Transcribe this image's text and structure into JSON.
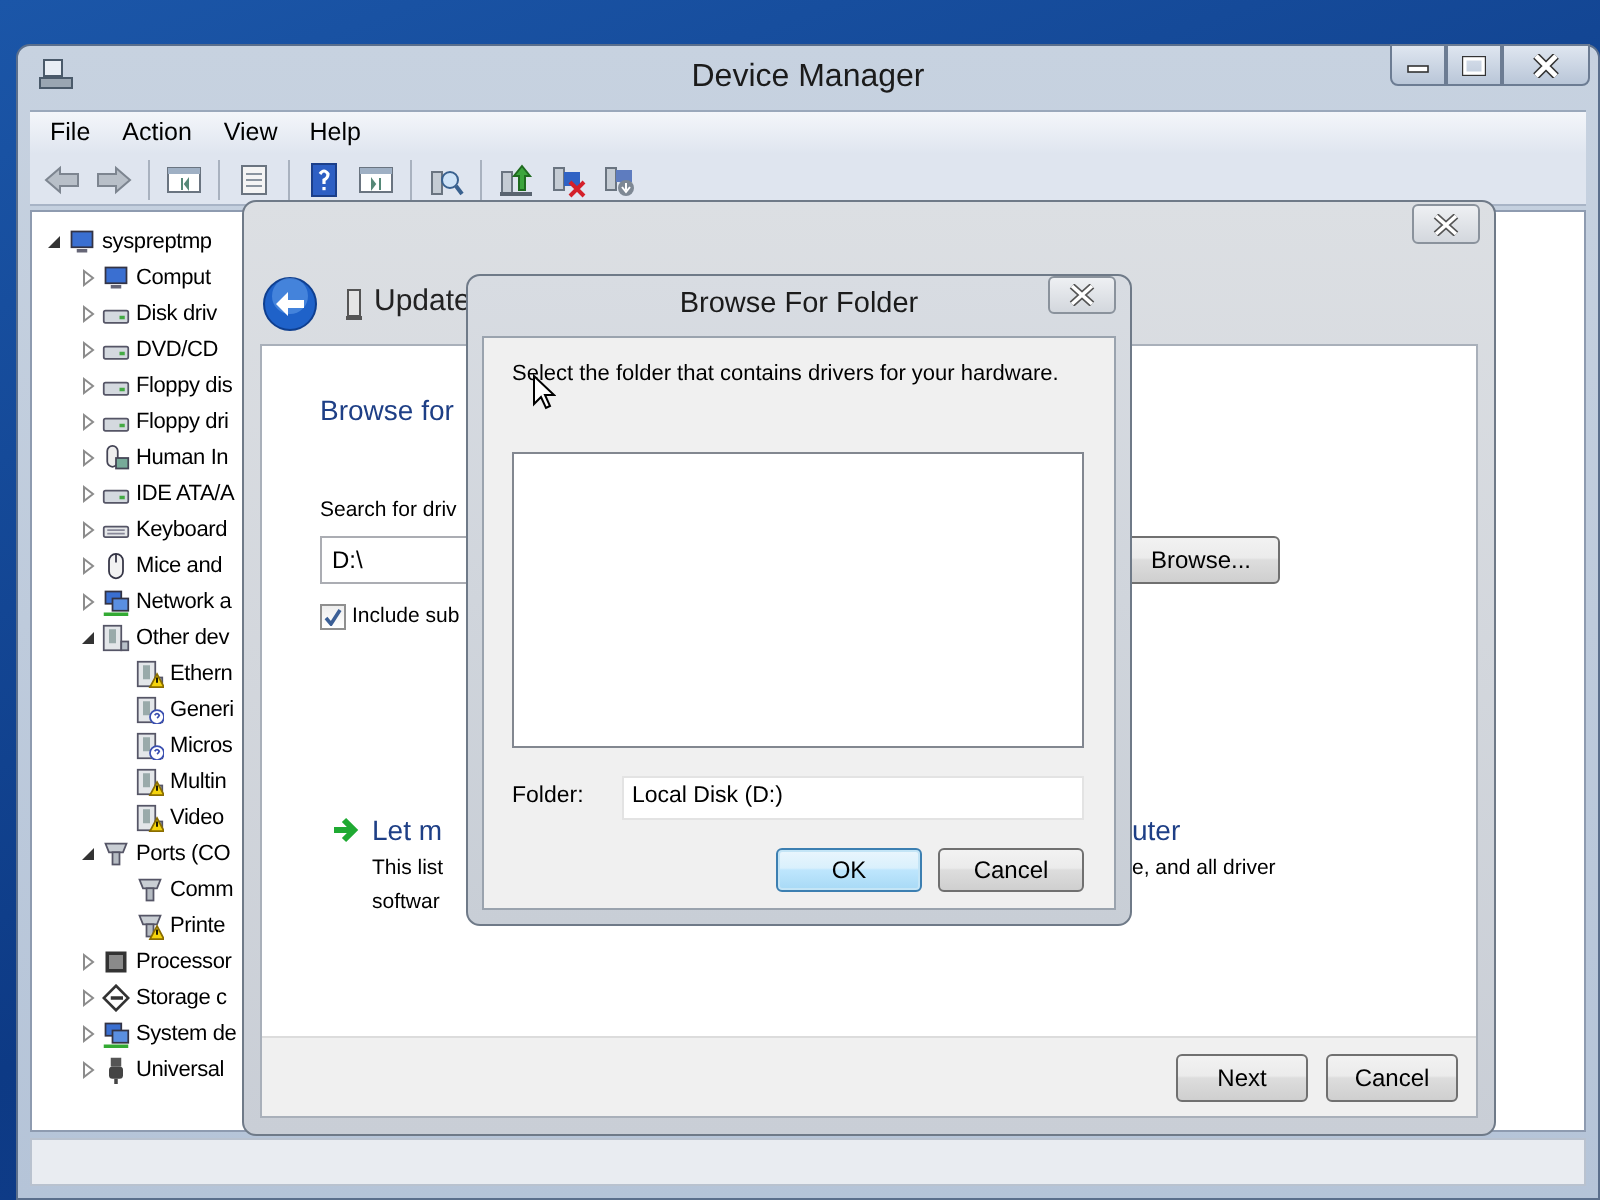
{
  "window": {
    "title": "Device Manager"
  },
  "menu": [
    "File",
    "Action",
    "View",
    "Help"
  ],
  "tree": {
    "label": "syspreptmp",
    "kind": "category",
    "expanded": true,
    "children": [
      {
        "label": "Comput",
        "kind": "category",
        "expanded": false
      },
      {
        "label": "Disk driv",
        "kind": "category",
        "expanded": false
      },
      {
        "label": "DVD/CD",
        "kind": "category",
        "expanded": false
      },
      {
        "label": "Floppy dis",
        "kind": "category",
        "expanded": false
      },
      {
        "label": "Floppy dri",
        "kind": "category",
        "expanded": false
      },
      {
        "label": "Human In",
        "kind": "category",
        "expanded": false
      },
      {
        "label": "IDE ATA/A",
        "kind": "category",
        "expanded": false
      },
      {
        "label": "Keyboard",
        "kind": "category",
        "expanded": false
      },
      {
        "label": "Mice and",
        "kind": "category",
        "expanded": false
      },
      {
        "label": "Network a",
        "kind": "category",
        "expanded": false
      },
      {
        "label": "Other dev",
        "kind": "category",
        "expanded": true,
        "children": [
          {
            "label": "Ethern",
            "kind": "device",
            "warning": true,
            "unknown": false
          },
          {
            "label": "Generi",
            "kind": "device",
            "warning": false,
            "unknown": true
          },
          {
            "label": "Micros",
            "kind": "device",
            "warning": false,
            "unknown": true
          },
          {
            "label": "Multin",
            "kind": "device",
            "warning": true,
            "unknown": false
          },
          {
            "label": "Video",
            "kind": "device",
            "warning": true,
            "unknown": false
          }
        ]
      },
      {
        "label": "Ports (CO",
        "kind": "category",
        "expanded": true,
        "children": [
          {
            "label": "Comm",
            "kind": "device",
            "warning": false,
            "unknown": false
          },
          {
            "label": "Printe",
            "kind": "device",
            "warning": true,
            "unknown": false
          }
        ]
      },
      {
        "label": "Processor",
        "kind": "category",
        "expanded": false
      },
      {
        "label": "Storage c",
        "kind": "category",
        "expanded": false
      },
      {
        "label": "System de",
        "kind": "category",
        "expanded": false
      },
      {
        "label": "Universal",
        "kind": "category",
        "expanded": false
      }
    ]
  },
  "wizard": {
    "title": "Update",
    "heading": "Browse for",
    "search_label": "Search for driv",
    "path": "D:\\",
    "browse_button": "Browse...",
    "include_subfolders": {
      "label": "Include sub",
      "checked": true
    },
    "option": {
      "title": "Let m",
      "title_tail": "uter",
      "description": "This list",
      "description_tail": "e, and all driver",
      "description_line2": "softwar"
    },
    "buttons": [
      "Next",
      "Cancel"
    ]
  },
  "browse_dialog": {
    "title": "Browse For Folder",
    "instruction": "Select the folder that contains drivers for your hardware.",
    "folder_label": "Folder:",
    "folder": "Local Disk (D:)",
    "buttons": [
      {
        "label": "OK",
        "default": true
      },
      {
        "label": "Cancel",
        "default": false
      }
    ]
  }
}
